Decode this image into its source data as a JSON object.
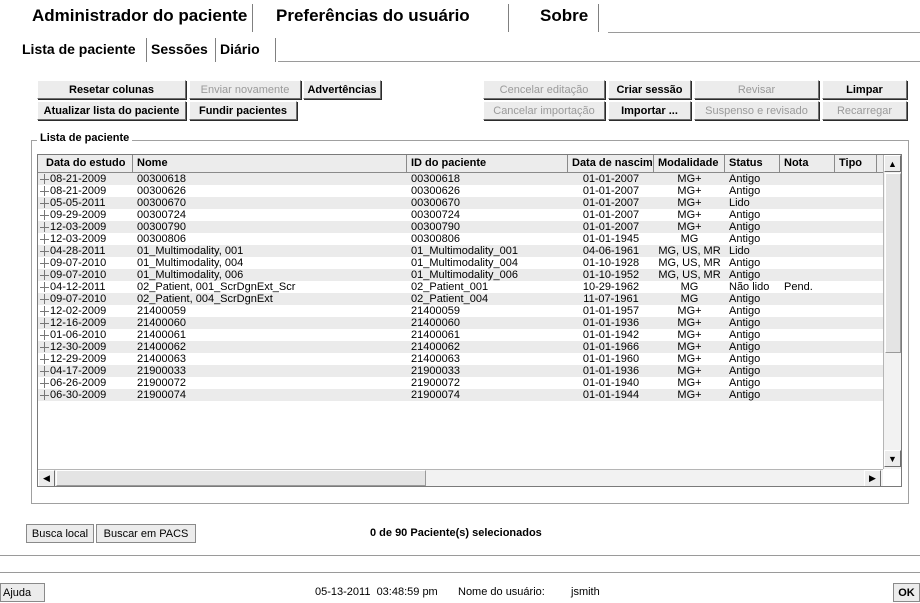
{
  "main_tabs": [
    {
      "label": "Administrador do paciente"
    },
    {
      "label": "Preferências do usuário"
    },
    {
      "label": "Sobre"
    }
  ],
  "sub_tabs": [
    {
      "label": "Lista de paciente"
    },
    {
      "label": "Sessões"
    },
    {
      "label": "Diário"
    }
  ],
  "toolbar": {
    "reset_columns": "Resetar colunas",
    "resend": "Enviar novamente",
    "warnings": "Advertências",
    "cancel_edit": "Cencelar editação",
    "create_session": "Criar sessão",
    "review": "Revisar",
    "clear": "Limpar",
    "refresh_list": "Atualizar lista do paciente",
    "merge_patients": "Fundir pacientes",
    "cancel_import": "Cancelar importação",
    "import": "Importar ...",
    "suspend_review": "Suspenso e revisado",
    "reload": "Recarregar"
  },
  "group_title": "Lista de paciente",
  "columns": [
    "Data do estudo",
    "Nome",
    "ID do paciente",
    "Data de nascimento",
    "Modalidade",
    "Status",
    "Nota",
    "Tipo"
  ],
  "rows": [
    [
      "08-21-2009",
      "00300618",
      "00300618",
      "01-01-2007",
      "MG+",
      "Antigo",
      ""
    ],
    [
      "08-21-2009",
      "00300626",
      "00300626",
      "01-01-2007",
      "MG+",
      "Antigo",
      ""
    ],
    [
      "05-05-2011",
      "00300670",
      "00300670",
      "01-01-2007",
      "MG+",
      "Lido",
      ""
    ],
    [
      "09-29-2009",
      "00300724",
      "00300724",
      "01-01-2007",
      "MG+",
      "Antigo",
      ""
    ],
    [
      "12-03-2009",
      "00300790",
      "00300790",
      "01-01-2007",
      "MG+",
      "Antigo",
      ""
    ],
    [
      "12-03-2009",
      "00300806",
      "00300806",
      "01-01-1945",
      "MG",
      "Antigo",
      ""
    ],
    [
      "04-28-2011",
      "01_Multimodality, 001",
      "01_Multimodality_001",
      "04-06-1961",
      "MG, US, MR",
      "Lido",
      ""
    ],
    [
      "09-07-2010",
      "01_Multimodality, 004",
      "01_Multimodality_004",
      "01-10-1928",
      "MG, US, MR",
      "Antigo",
      ""
    ],
    [
      "09-07-2010",
      "01_Multimodality, 006",
      "01_Multimodality_006",
      "01-10-1952",
      "MG, US, MR",
      "Antigo",
      ""
    ],
    [
      "04-12-2011",
      "02_Patient, 001_ScrDgnExt_Scr",
      "02_Patient_001",
      "10-29-1962",
      "MG",
      "Não lido",
      "Pend."
    ],
    [
      "09-07-2010",
      "02_Patient, 004_ScrDgnExt",
      "02_Patient_004",
      "11-07-1961",
      "MG",
      "Antigo",
      ""
    ],
    [
      "12-02-2009",
      "21400059",
      "21400059",
      "01-01-1957",
      "MG+",
      "Antigo",
      ""
    ],
    [
      "12-16-2009",
      "21400060",
      "21400060",
      "01-01-1936",
      "MG+",
      "Antigo",
      ""
    ],
    [
      "01-06-2010",
      "21400061",
      "21400061",
      "01-01-1942",
      "MG+",
      "Antigo",
      ""
    ],
    [
      "12-30-2009",
      "21400062",
      "21400062",
      "01-01-1966",
      "MG+",
      "Antigo",
      ""
    ],
    [
      "12-29-2009",
      "21400063",
      "21400063",
      "01-01-1960",
      "MG+",
      "Antigo",
      ""
    ],
    [
      "04-17-2009",
      "21900033",
      "21900033",
      "01-01-1936",
      "MG+",
      "Antigo",
      ""
    ],
    [
      "06-26-2009",
      "21900072",
      "21900072",
      "01-01-1940",
      "MG+",
      "Antigo",
      ""
    ],
    [
      "06-30-2009",
      "21900074",
      "21900074",
      "01-01-1944",
      "MG+",
      "Antigo",
      ""
    ]
  ],
  "bottom": {
    "local_search": "Busca local",
    "pacs_search": "Buscar em PACS",
    "selection_status": "0 de 90 Paciente(s) selecionados"
  },
  "footer": {
    "help": "Ajuda",
    "datetime": "05-13-2011  03:48:59 pm",
    "user_label": "Nome do usuário:",
    "user": "jsmith",
    "ok": "OK"
  },
  "icons": {
    "scroll_up": "up-arrow-icon",
    "scroll_down": "down-arrow-icon",
    "scroll_left": "left-arrow-icon",
    "scroll_right": "right-arrow-icon",
    "expand": "plus-expand-icon"
  }
}
